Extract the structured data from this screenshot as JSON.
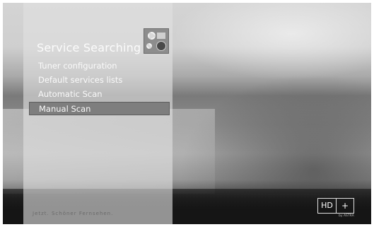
{
  "menu": {
    "title": "Service Searching",
    "items": [
      {
        "label": "Tuner configuration"
      },
      {
        "label": "Default services lists"
      },
      {
        "label": "Automatic Scan"
      },
      {
        "label": "Manual Scan",
        "selected": true
      }
    ],
    "icon": "settings-icon"
  },
  "footer": {
    "ticker": "Jetzt. Schöner Fernsehen.",
    "logo_hd": "HD",
    "logo_plus": "+",
    "logo_sub": "by ASTRA"
  },
  "colors": {
    "selected_bg": "#7e7e7e",
    "menu_text": "#fafafa"
  }
}
